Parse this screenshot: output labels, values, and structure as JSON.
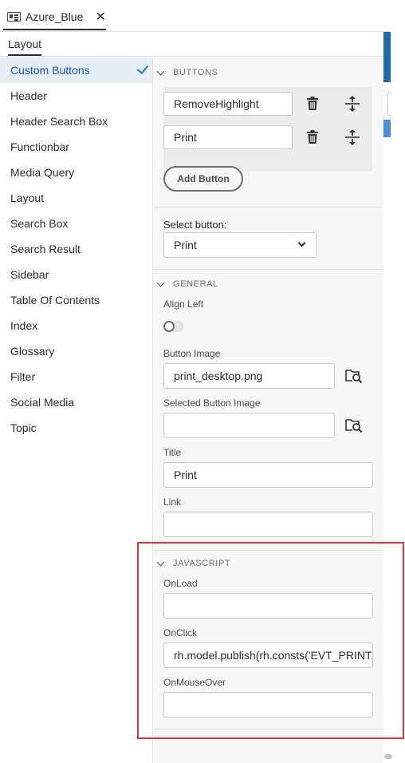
{
  "window": {
    "tab_title": "Azure_Blue",
    "close_glyph": "✕",
    "tab_icon": "layout-window-icon"
  },
  "subtabs": {
    "active": "Layout"
  },
  "sidebar": {
    "items": [
      {
        "label": "Custom Buttons",
        "active": true
      },
      {
        "label": "Header"
      },
      {
        "label": "Header Search Box"
      },
      {
        "label": "Functionbar"
      },
      {
        "label": "Media Query"
      },
      {
        "label": "Layout"
      },
      {
        "label": "Search Box"
      },
      {
        "label": "Search Result"
      },
      {
        "label": "Sidebar"
      },
      {
        "label": "Table Of Contents"
      },
      {
        "label": "Index"
      },
      {
        "label": "Glossary"
      },
      {
        "label": "Filter"
      },
      {
        "label": "Social Media"
      },
      {
        "label": "Topic"
      }
    ]
  },
  "buttons_section": {
    "heading": "BUTTONS",
    "buttons": [
      {
        "name": "RemoveHighlight"
      },
      {
        "name": "Print"
      }
    ],
    "add_label": "Add Button",
    "icons": {
      "delete": "trash-icon",
      "move": "reorder-icon"
    }
  },
  "select_button": {
    "label": "Select button:",
    "value": "Print"
  },
  "general": {
    "heading": "GENERAL",
    "align_left": {
      "label": "Align Left",
      "on": false
    },
    "button_image": {
      "label": "Button Image",
      "value": "print_desktop.png"
    },
    "selected_button_image": {
      "label": "Selected Button Image",
      "value": ""
    },
    "title": {
      "label": "Title",
      "value": "Print"
    },
    "link": {
      "label": "Link",
      "value": ""
    },
    "browse_icon": "folder-search-icon"
  },
  "javascript": {
    "heading": "JAVASCRIPT",
    "onload": {
      "label": "OnLoad",
      "value": ""
    },
    "onclick": {
      "label": "OnClick",
      "value": "rh.model.publish(rh.consts('EVT_PRINT..."
    },
    "onmouseover": {
      "label": "OnMouseOver",
      "value": ""
    }
  },
  "colors": {
    "accent": "#2b74d1",
    "active_item_bg": "#e6eef8",
    "highlight": "#d9383a",
    "panel_bg": "#f7f7f7"
  }
}
